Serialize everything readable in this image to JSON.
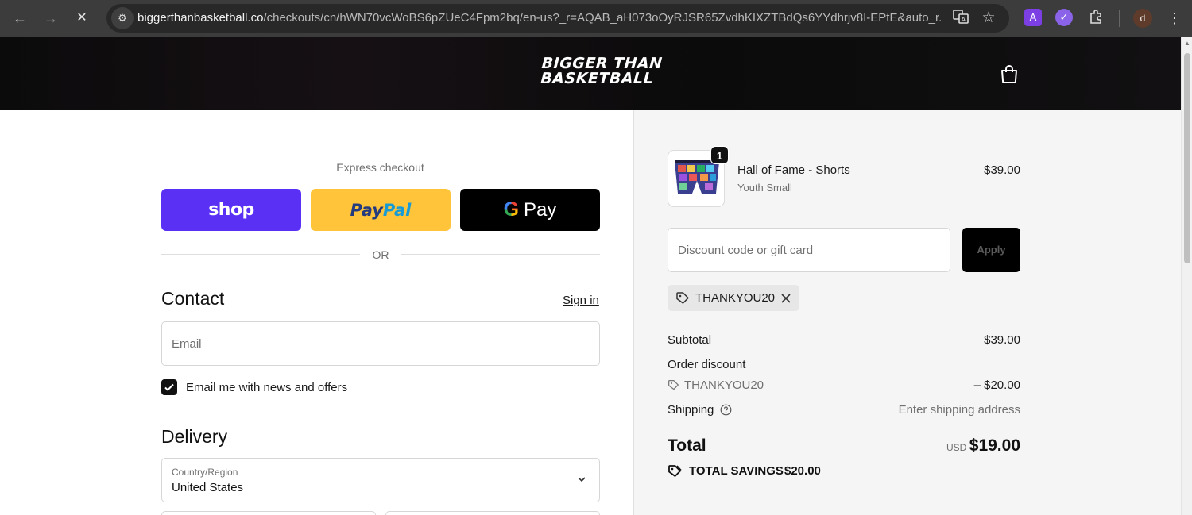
{
  "browser": {
    "url_domain": "biggerthanbasketball.co",
    "url_path": "/checkouts/cn/hWN70vcWoBS6pZUeC4Fpm2bq/en-us?_r=AQAB_aH073oOyRJSR65ZvdhKIXZTBdQs6YYdhrjv8I-EPtE&auto_r...",
    "profile_initial": "d",
    "extension_letter": "A"
  },
  "header": {
    "logo_line1": "BIGGER THAN",
    "logo_line2": "BASKETBALL"
  },
  "express": {
    "label": "Express checkout",
    "shop_label": "shop",
    "paypal_part1": "Pay",
    "paypal_part2": "Pal",
    "gpay_g": "G",
    "gpay_label": "Pay",
    "or_text": "OR"
  },
  "contact": {
    "title": "Contact",
    "signin": "Sign in",
    "email_placeholder": "Email",
    "newsletter_label": "Email me with news and offers"
  },
  "delivery": {
    "title": "Delivery",
    "country_label": "Country/Region",
    "country_value": "United States"
  },
  "cart": {
    "item": {
      "name": "Hall of Fame - Shorts",
      "variant": "Youth Small",
      "price": "$39.00",
      "quantity": "1"
    },
    "discount_placeholder": "Discount code or gift card",
    "apply_label": "Apply",
    "applied_code": "THANKYOU20"
  },
  "summary": {
    "subtotal_label": "Subtotal",
    "subtotal_value": "$39.00",
    "order_discount_label": "Order discount",
    "discount_code": "THANKYOU20",
    "discount_value": "– $20.00",
    "shipping_label": "Shipping",
    "shipping_value": "Enter shipping address",
    "total_label": "Total",
    "currency": "USD",
    "total_value": "$19.00",
    "savings_label": "TOTAL SAVINGS",
    "savings_value": "$20.00"
  },
  "colors": {
    "shop_purple": "#5a31f4",
    "paypal_yellow": "#ffc439",
    "summary_bg": "#f5f5f5"
  }
}
